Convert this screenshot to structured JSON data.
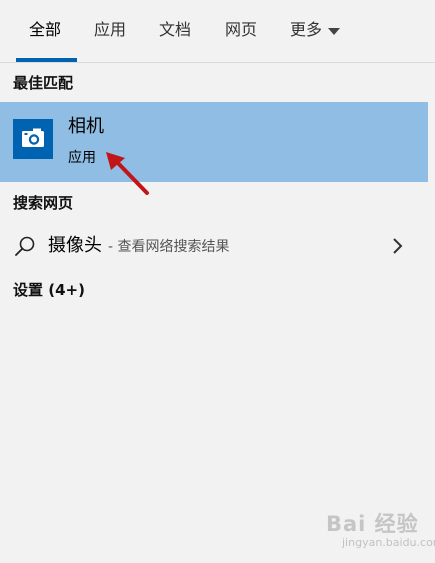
{
  "tabs": [
    {
      "label": "全部",
      "active": true
    },
    {
      "label": "应用",
      "active": false
    },
    {
      "label": "文档",
      "active": false
    },
    {
      "label": "网页",
      "active": false
    },
    {
      "label": "更多",
      "active": false
    }
  ],
  "best_match": {
    "heading": "最佳匹配",
    "title": "相机",
    "subtitle": "应用",
    "icon": "camera-icon"
  },
  "web_search": {
    "heading": "搜索网页",
    "term": "摄像头",
    "hint": "- 查看网络搜索结果"
  },
  "settings": {
    "heading": "设置 (4+)"
  },
  "watermark": {
    "brand": "Bai 经验",
    "sub": "jingyan.baidu.com"
  },
  "colors": {
    "accent": "#0063b1",
    "selected_bg": "#8fbde3",
    "page_bg": "#f2f2f2",
    "arrow": "#c0161a"
  }
}
